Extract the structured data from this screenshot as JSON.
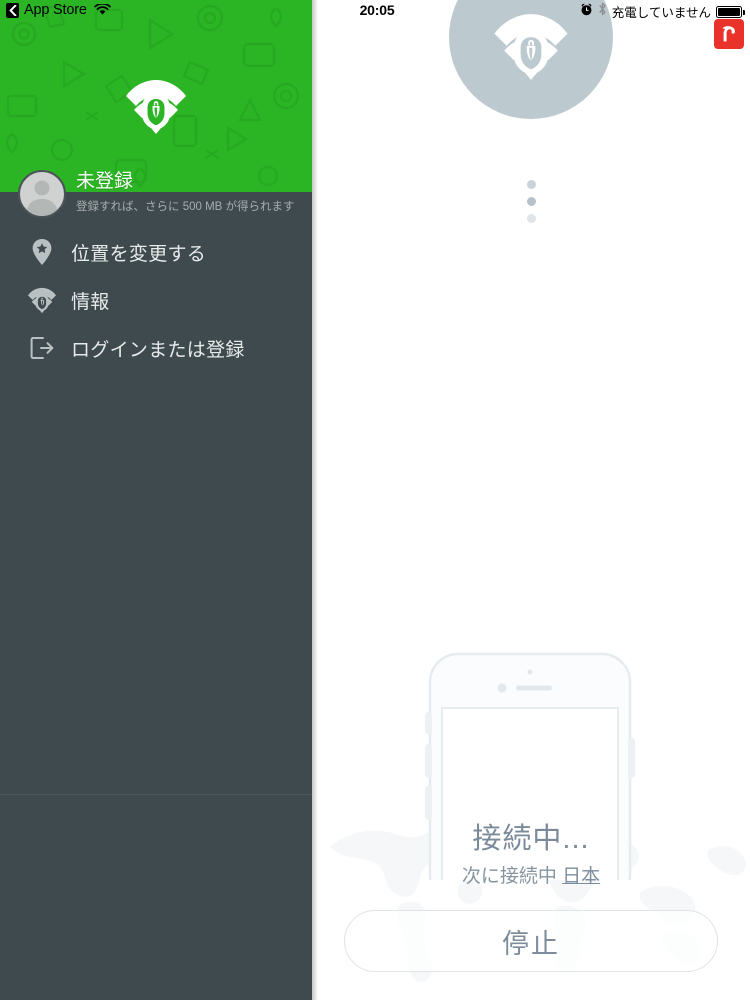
{
  "status_bar_left": {
    "back_icon": "chevron-left-icon",
    "back_label": "App Store",
    "wifi_icon": "wifi-icon"
  },
  "status_bar_right": {
    "time": "20:05",
    "alarm_icon": "alarm-clock-icon",
    "bluetooth_icon": "bluetooth-icon",
    "charging_status": "充電していません",
    "battery_icon": "battery-full-icon"
  },
  "badge": {
    "name": "avira-logo-badge",
    "color": "#e8322a"
  },
  "sidebar": {
    "header_color": "#2bb424",
    "background_color": "#3f4a4f",
    "logo_icon": "phantom-vpn-logo-icon",
    "user": {
      "avatar_icon": "user-avatar-icon",
      "name": "未登録",
      "subtitle": "登録すれば、さらに 500 MB が得られます"
    },
    "items": [
      {
        "icon": "map-pin-star-icon",
        "label": "位置を変更する"
      },
      {
        "icon": "vpn-shield-icon",
        "label": "情報"
      },
      {
        "icon": "logout-icon",
        "label": "ログインまたは登録"
      }
    ]
  },
  "main": {
    "hero_icon": "phantom-vpn-logo-icon",
    "hero_circle_color": "#bcc9cf",
    "loading_dots": 3,
    "phone_illustration_icon": "iphone-outline-icon",
    "world_map_icon": "world-map-watermark",
    "status_title": "接続中...",
    "status_subtitle_prefix": "次に接続中 ",
    "status_location": "日本",
    "stop_button_label": "停止"
  }
}
